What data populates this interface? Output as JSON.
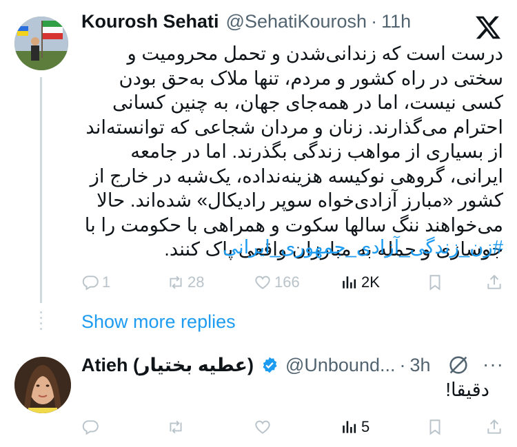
{
  "tweet1": {
    "name": "Kourosh Sehati",
    "handle": "@SehatiKourosh",
    "dot": "·",
    "time": "11h",
    "text": "درست است که زندانی‌شدن و تحمل محرومیت و سختی در راه کشور و مردم، تنها ملاک به‌حق بودن کسی نیست، اما در همه‌جای جهان، به چنین کسانی احترام می‌گذارند. زنان و مردان شجاعی که توانسته‌اند از بسیاری از مواهب زندگی بگذرند. اما در جامعه ایرانی، گروهی نوکیسه هزینه‌نداده، یک‌شبه در خارج از کشور «مبارز آزادی‌خواه سوپر رادیکال» شده‌اند. حالا می‌خواهند ننگ سالها سکوت و همراهی با حکومت را با جوسازی و حمله به مبارزان واقعی پاک کنند.",
    "hashtag": "#زن_زندگی_آزادی_جمهوری_ایرانی",
    "replies": "1",
    "retweets": "28",
    "likes": "166",
    "views": "2K"
  },
  "show_more": "Show more replies",
  "tweet2": {
    "name": "Atieh (عطیه بختیار)",
    "handle": "@Unbound...",
    "dot": "·",
    "time": "3h",
    "text": "دقیقا!",
    "views": "5"
  },
  "icons": {
    "logo": "x-logo-icon",
    "reply": "reply-icon",
    "retweet": "retweet-icon",
    "like": "heart-icon",
    "views": "views-icon",
    "bookmark": "bookmark-icon",
    "share": "share-icon",
    "grok": "grok-icon",
    "more": "more-icon",
    "verified": "verified-badge-icon"
  },
  "colors": {
    "text": "#0f1419",
    "muted": "#536471",
    "accent": "#1d9bf0",
    "disabled": "#b9c3ca",
    "thread": "#cfd9de"
  }
}
